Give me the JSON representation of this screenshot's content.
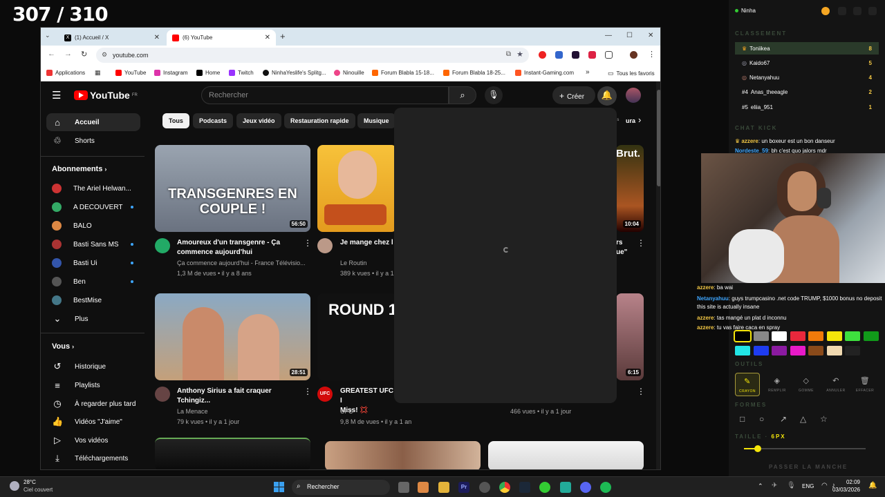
{
  "counter": "307 / 310",
  "browser": {
    "tabs": [
      {
        "label": "(1) Accueil / X",
        "icon": "x-icon"
      },
      {
        "label": "(6) YouTube",
        "icon": "youtube-icon"
      }
    ],
    "url": "youtube.com",
    "bookmarks": [
      "Applications",
      "YouTube",
      "Instagram",
      "Home",
      "Twitch",
      "NinhaYeslife's Splitg...",
      "Ninouille",
      "Forum Blabla 15-18...",
      "Forum Blabla 18-25...",
      "Instant-Gaming.com"
    ],
    "bookmarks_more": "»",
    "all_favorites": "Tous les favoris"
  },
  "youtube": {
    "logo": "YouTube",
    "logo_country": "FR",
    "search_placeholder": "Rechercher",
    "create_label": "Créer",
    "sidebar": {
      "main": [
        {
          "label": "Accueil",
          "icon": "home-icon"
        },
        {
          "label": "Shorts",
          "icon": "shorts-icon"
        }
      ],
      "subs_header": "Abonnements",
      "subs": [
        {
          "label": "The Ariel Helwan...",
          "color": "#c33"
        },
        {
          "label": "A DECOUVERT",
          "color": "#3a6"
        },
        {
          "label": "BALO",
          "color": "#d84"
        },
        {
          "label": "Basti Sans MS",
          "color": "#a33"
        },
        {
          "label": "Basti Ui",
          "color": "#35a"
        },
        {
          "label": "Ben",
          "color": "#555"
        },
        {
          "label": "BestMise",
          "color": "#478"
        }
      ],
      "more": "Plus",
      "you_header": "Vous",
      "you": [
        {
          "label": "Historique",
          "icon": "history-icon"
        },
        {
          "label": "Playlists",
          "icon": "playlist-icon"
        },
        {
          "label": "À regarder plus tard",
          "icon": "clock-icon"
        },
        {
          "label": "Vidéos \"J'aime\"",
          "icon": "thumbs-up-icon"
        },
        {
          "label": "Vos vidéos",
          "icon": "video-icon"
        },
        {
          "label": "Téléchargements",
          "icon": "download-icon"
        }
      ]
    },
    "chips": [
      "Tous",
      "Podcasts",
      "Jeux vidéo",
      "Restauration rapide",
      "Musique"
    ],
    "chip_partial": "ns",
    "chip_partial2": "ura",
    "videos": [
      {
        "title": "Amoureux d'un transgenre - Ça commence aujourd'hui",
        "channel": "Ça commence aujourd'hui - France Télévisio...",
        "meta": "1,3 M de vues • il y a 8 ans",
        "duration": "56:50",
        "thumb_text": "TRANSGENRES EN COUPLE !"
      },
      {
        "title": "Je mange chez l",
        "channel": "Le Routin",
        "meta": "389 k vues • il y a 1",
        "duration": "",
        "thumb_text": ""
      },
      {
        "title": "rs",
        "title2": "ue\"",
        "channel": "",
        "meta": "",
        "duration": "10:04",
        "thumb_text": "Brut."
      },
      {
        "title": "Anthony Sirius a fait craquer Tchingiz...",
        "channel": "La Menace",
        "meta": "79 k vues • il y a 1 jour",
        "duration": "28:51",
        "thumb_text": ""
      },
      {
        "title": "GREATEST UFC I",
        "title2": "Miss! 💢",
        "channel": "UFC",
        "meta": "9,8 M de vues • il y a 1 an",
        "duration": "",
        "thumb_text": "ROUND 1"
      },
      {
        "title": "",
        "channel": "",
        "meta": "466 vues • il y a 1 jour",
        "duration": "6:15",
        "thumb_text": ""
      }
    ]
  },
  "panel": {
    "user": "Ninha",
    "ranking_label": "CLASSEMENT",
    "ranking": [
      {
        "pos": "",
        "name": "Toniikea",
        "score": "8"
      },
      {
        "pos": "",
        "name": "Kaido67",
        "score": "5"
      },
      {
        "pos": "",
        "name": "Netanyahuu",
        "score": "4"
      },
      {
        "pos": "#4",
        "name": "Anas_theeagle",
        "score": "2"
      },
      {
        "pos": "#5",
        "name": "eliia_951",
        "score": "1"
      }
    ],
    "chat_label": "CHAT KICK",
    "chat_top": [
      {
        "user": "azzere",
        "text": "un boxeur est un bon danseur"
      },
      {
        "user": "Nordeste_59",
        "text": "bh c'est quo jalors mdr"
      }
    ],
    "chat_bottom": [
      {
        "user": "azzere",
        "text": "ba wai"
      },
      {
        "user": "Netanyahuu",
        "text": "guys trumpcasino .net code TRUMP, $1000 bonus no deposit this site is actually insane"
      },
      {
        "user": "azzere",
        "text": "tas mangé un plat d inconnu"
      },
      {
        "user": "azzere",
        "text": "tu vas faire caca en spray"
      }
    ],
    "colors": [
      "#000000",
      "#888888",
      "#ffffff",
      "#e8283c",
      "#f07a0a",
      "#f5e60a",
      "#3ee03e",
      "#119a1a",
      "#22e5e5",
      "#1e3cf0",
      "#8a1aa0",
      "#e81ac8",
      "#8a4a1a",
      "#f0d9b0",
      "#222222"
    ],
    "tools_label": "OUTILS",
    "tools": [
      "CRAYON",
      "REMPLIR",
      "GOMME",
      "ANNULER",
      "EFFACER"
    ],
    "shapes_label": "FORMES",
    "size_label": "TAILLE",
    "size_value": "6PX",
    "pass_label": "PASSER LA MANCHE"
  },
  "taskbar": {
    "weather_temp": "28°C",
    "weather_desc": "Ciel couvert",
    "search": "Rechercher",
    "lang": "ENG",
    "time": "02:09",
    "date": "03/03/2026"
  }
}
